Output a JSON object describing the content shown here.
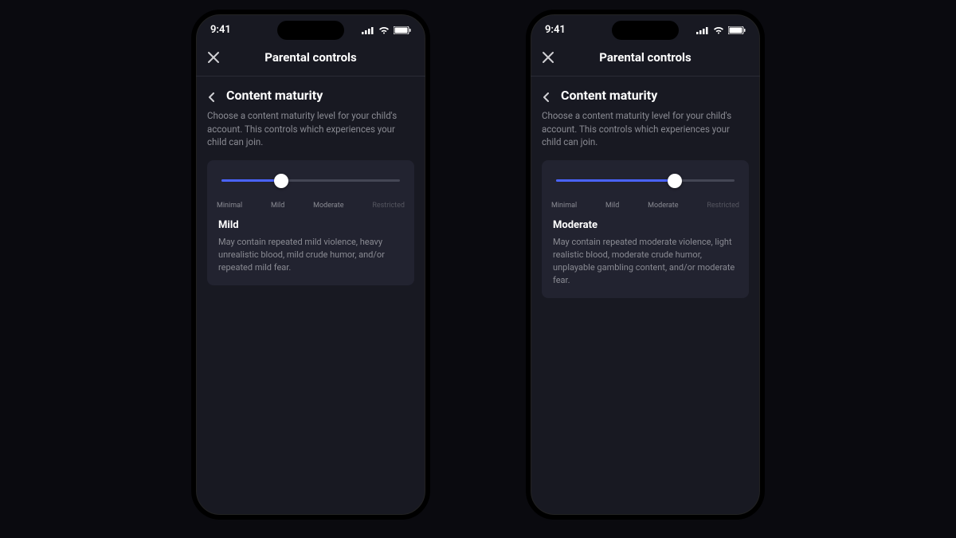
{
  "status": {
    "time": "9:41"
  },
  "nav": {
    "title": "Parental controls"
  },
  "section": {
    "title": "Content maturity",
    "desc": "Choose a content maturity level for your child's account. This controls which experiences your child can join."
  },
  "slider": {
    "ticks": [
      "Minimal",
      "Mild",
      "Moderate",
      "Restricted"
    ]
  },
  "phones": [
    {
      "selected_index": 1,
      "level_name": "Mild",
      "level_desc": "May contain repeated mild violence, heavy unrealistic blood, mild crude humor, and/or repeated mild fear."
    },
    {
      "selected_index": 2,
      "level_name": "Moderate",
      "level_desc": "May contain repeated moderate violence, light realistic blood, moderate crude humor, unplayable gambling content, and/or moderate fear."
    }
  ]
}
